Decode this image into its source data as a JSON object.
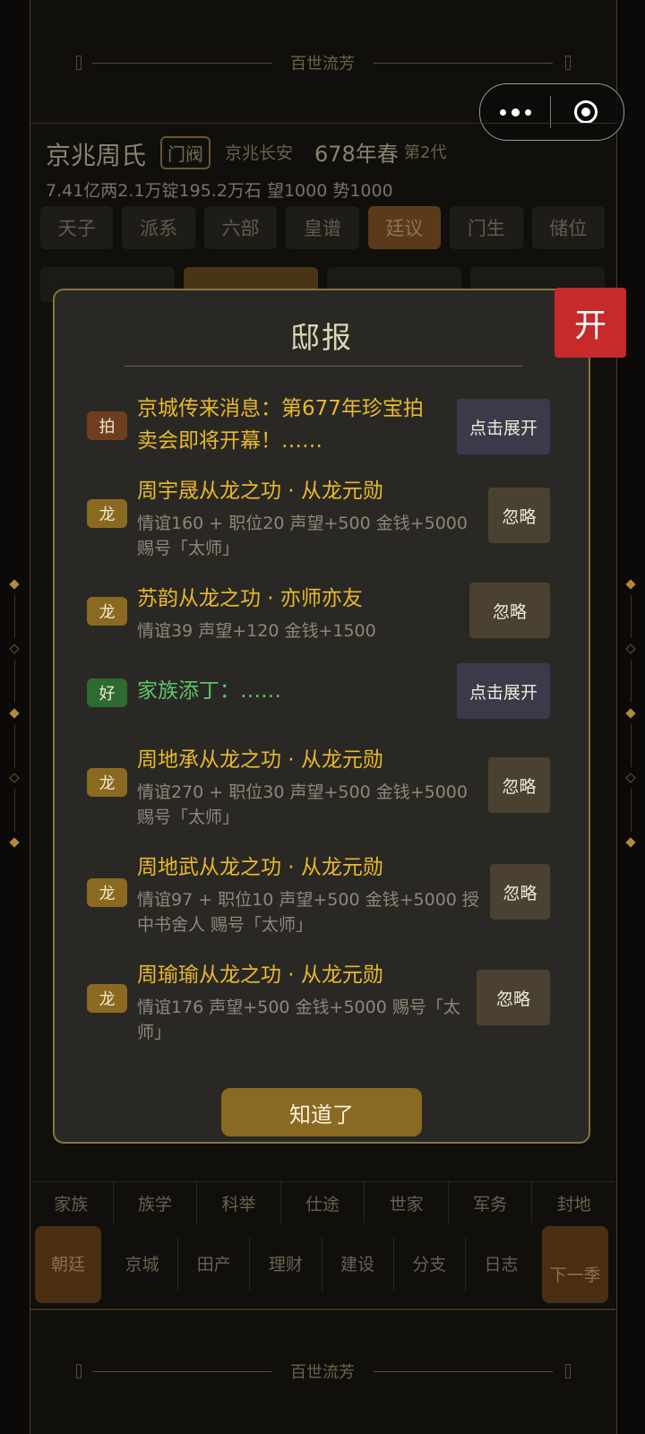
{
  "app": {
    "banner_title": "百世流芳"
  },
  "header": {
    "clan_name": "京兆周氏",
    "rank": "门阀",
    "location": "京兆长安",
    "year": "678年春",
    "generation": "第2代",
    "wealth": "7.41亿两2.1万锭195.2万石  望1000  势1000"
  },
  "court_tabs": [
    "天子",
    "派系",
    "六部",
    "皇谱",
    "廷议",
    "门生",
    "储位"
  ],
  "floating_open_label": "开",
  "modal": {
    "title": "邸报",
    "ok_label": "知道了",
    "items": [
      {
        "badge": "拍",
        "headline": "京城传来消息：第677年珍宝拍",
        "headline2": "卖会即将开幕！……",
        "button": "点击展开"
      },
      {
        "badge": "龙",
        "headline": "周宇晟从龙之功 · 从龙元勋",
        "detail1": "情谊160 + 职位20 声望+500 金钱+5000",
        "detail2": "赐号「太师」",
        "button": "忽略"
      },
      {
        "badge": "龙",
        "headline": "苏韵从龙之功 · 亦师亦友",
        "detail1": "情谊39 声望+120 金钱+1500",
        "button": "忽略"
      },
      {
        "badge": "好",
        "headline": "家族添丁：……",
        "button": "点击展开"
      },
      {
        "badge": "龙",
        "headline": "周地承从龙之功 · 从龙元勋",
        "detail1": "情谊270 + 职位30 声望+500 金钱+5000",
        "detail2": "赐号「太师」",
        "button": "忽略"
      },
      {
        "badge": "龙",
        "headline": "周地武从龙之功 · 从龙元勋",
        "detail1": "情谊97 + 职位10 声望+500 金钱+5000 授",
        "detail2": "中书舍人 赐号「太师」",
        "button": "忽略"
      },
      {
        "badge": "龙",
        "headline": "周瑜瑜从龙之功 · 从龙元勋",
        "detail1": "情谊176 声望+500 金钱+5000 赐号「太",
        "detail2": "师」",
        "button": "忽略"
      }
    ]
  },
  "bottom_nav_top": [
    "家族",
    "族学",
    "科举",
    "仕途",
    "世家",
    "军务",
    "封地"
  ],
  "bottom_nav_main": [
    "朝廷",
    "京城",
    "田产",
    "理财",
    "建设",
    "分支",
    "日志",
    "下一季"
  ]
}
